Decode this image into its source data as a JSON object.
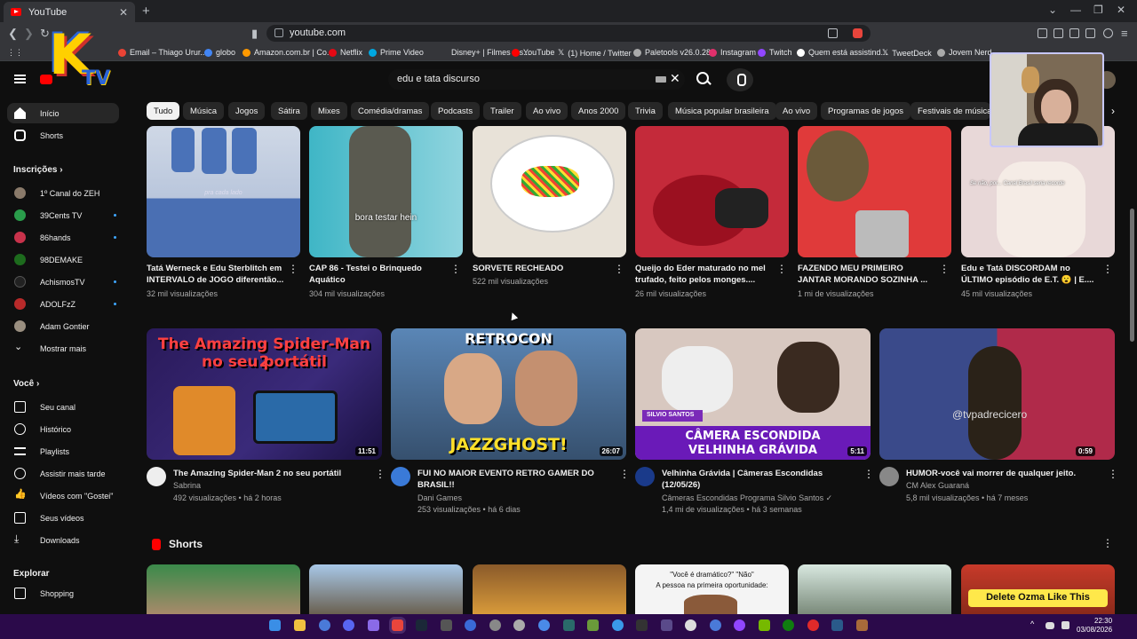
{
  "browser": {
    "tab_title": "YouTube",
    "url": "youtube.com",
    "bookmarks": [
      "Email – Thiago Urur...",
      "globo",
      "Amazon.com.br | Co...",
      "Netflix",
      "Prime Video",
      "Disney+ | Filmes e s...",
      "YouTube",
      "(1) Home / Twitter",
      "Paletools v26.0.28",
      "Instagram",
      "Twitch",
      "Quem está assistind...",
      "TweetDeck",
      "Jovem Nerd"
    ]
  },
  "overlay": {
    "logo_letter": "K",
    "logo_sub": "TV"
  },
  "search": {
    "query": "edu e tata discurso"
  },
  "chips": [
    "Tudo",
    "Música",
    "Jogos",
    "Sátira",
    "Mixes",
    "Comédia/dramas",
    "Podcasts",
    "Trailer",
    "Ao vivo",
    "Anos 2000",
    "Trivia",
    "Música popular brasileira",
    "Ao vivo",
    "Programas de jogos",
    "Festivais de música"
  ],
  "sidebar": {
    "home": "Início",
    "shorts": "Shorts",
    "subs_header": "Inscrições",
    "channels": [
      "1º Canal do ZEH",
      "39Cents TV",
      "86hands",
      "98DEMAKE",
      "AchismosTV",
      "ADOLFzZ",
      "Adam Gontier"
    ],
    "show_more": "Mostrar mais",
    "you_header": "Você",
    "you_items": [
      "Seu canal",
      "Histórico",
      "Playlists",
      "Assistir mais tarde",
      "Vídeos com \"Gostei\"",
      "Seus vídeos",
      "Downloads"
    ],
    "explore_header": "Explorar",
    "shopping": "Shopping"
  },
  "row1": [
    {
      "title1": "Tatá Werneck e Edu Sterblitch em",
      "title2": "INTERVALO de JOGO diferentão...",
      "views": "32 mil visualizações",
      "caption": "pra cada lado"
    },
    {
      "title1": "CAP 86 - Testei o Brinquedo",
      "title2": "Aquático",
      "views": "304 mil visualizações",
      "caption": "bora testar hein"
    },
    {
      "title1": "SORVETE RECHEADO",
      "title2": "",
      "views": "522 mil visualizações",
      "caption": ""
    },
    {
      "title1": "Queijo do Eder maturado no mel",
      "title2": "trufado, feito pelos monges....",
      "views": "26 mil visualizações",
      "caption": ""
    },
    {
      "title1": "FAZENDO MEU PRIMEIRO",
      "title2": "JANTAR MORANDO SOZINHA ...",
      "views": "1 mi de visualizações",
      "caption": ""
    },
    {
      "title1": "Edu e Tatá DISCORDAM no",
      "title2": "ÚLTIMO episódio de E.T. 😮 | E....",
      "views": "45 mil visualizações",
      "caption": "Se não, por... Canal Brasil seria recorde"
    }
  ],
  "row2": [
    {
      "title1": "The Amazing Spider-Man 2 no seu portátil",
      "title2": "",
      "channel": "Sabrina",
      "meta": "492 visualizações • há 2 horas",
      "duration": "11:51",
      "overlay1": "The Amazing Spider-Man 2",
      "overlay2": "no seu portátil"
    },
    {
      "title1": "FUI NO MAIOR EVENTO RETRO GAMER DO",
      "title2": "BRASIL!!",
      "channel": "Dani Games",
      "meta": "253 visualizações • há 6 dias",
      "duration": "26:07",
      "overlay1": "RETROCON",
      "overlay2": "JAZZGHOST!"
    },
    {
      "title1": "Velhinha Grávida | Câmeras Escondidas",
      "title2": "(12/05/26)",
      "channel": "Câmeras Escondidas Programa Silvio Santos",
      "meta": "1,4 mi de visualizações • há 3 semanas",
      "duration": "5:11",
      "overlay1": "CÂMERA ESCONDIDA",
      "overlay2": "VELHINHA GRÁVIDA",
      "brand": "SILVIO SANTOS"
    },
    {
      "title1": "HUMOR-você vai morrer de qualquer jeito.",
      "title2": "",
      "channel": "CM Alex Guaraná",
      "meta": "5,8 mil visualizações • há 7 meses",
      "duration": "0:59",
      "overlay1": "@tvpadrecicero",
      "overlay2": ""
    }
  ],
  "shorts": {
    "header": "Shorts",
    "card4_line1": "\"Você é dramático?\" \"Não\"",
    "card4_line2": "A pessoa na primeira oportunidade:",
    "card6_text": "Delete Ozma Like This"
  },
  "taskbar": {
    "time": "22:30",
    "date": "03/08/2026"
  },
  "colors": {
    "yt_red": "#ff0000",
    "bg": "#0f0f0f",
    "taskbar": "#2b0a4a"
  }
}
